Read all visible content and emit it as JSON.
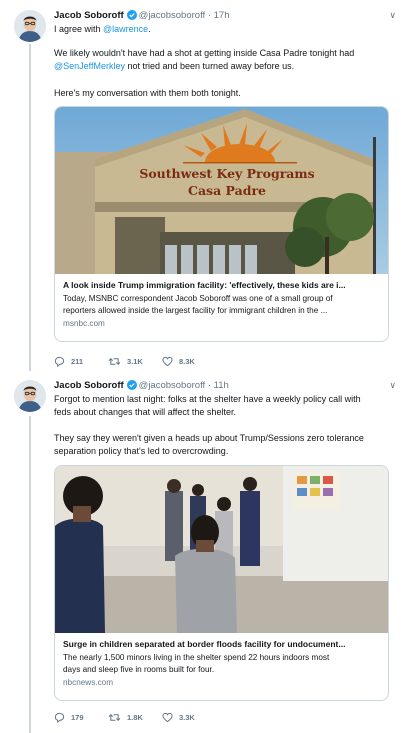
{
  "tweets": [
    {
      "author": "Jacob Soboroff",
      "handle": "@jacobsoboroff",
      "separator": "·",
      "time": "17h",
      "reply_prefix": "I agree with ",
      "reply_link": "@lawrence",
      "reply_suffix": ".",
      "para1_a": "We likely wouldn't have had a shot at getting inside Casa Padre tonight had",
      "para1_link": "@SenJeffMerkley",
      "para1_b": " not tried and been turned away before us.",
      "para2": "Here's my conversation with them both tonight.",
      "card": {
        "sign_line1": "Southwest Key Programs",
        "sign_line2": "Casa Padre",
        "title": "A look inside Trump immigration facility: 'effectively, these kids are i...",
        "desc1": "Today, MSNBC correspondent Jacob Soboroff was one of a small group of",
        "desc2": "reporters allowed inside the largest facility for immigrant children in the ...",
        "domain": "msnbc.com"
      },
      "replies": "211",
      "retweets": "3.1K",
      "likes": "8.3K"
    },
    {
      "author": "Jacob Soboroff",
      "handle": "@jacobsoboroff",
      "separator": "·",
      "time": "11h",
      "line1": "Forgot to mention last night: folks at the shelter have a weekly policy call with",
      "line2": "feds about changes that will affect the shelter.",
      "line3": "They say they weren't given a heads up about Trump/Sessions zero tolerance",
      "line4": "separation policy that's led to overcrowding.",
      "card": {
        "title": "Surge in children separated at border floods facility for undocument...",
        "desc1": "The nearly 1,500 minors living in the shelter spend 22 hours indoors most",
        "desc2": "days and sleep five in rooms built for four.",
        "domain": "nbcnews.com"
      },
      "replies": "179",
      "retweets": "1.8K",
      "likes": "3.3K"
    }
  ],
  "colors": {
    "accent": "#1b95e0",
    "muted": "#657786",
    "border": "#ccd6dd"
  }
}
